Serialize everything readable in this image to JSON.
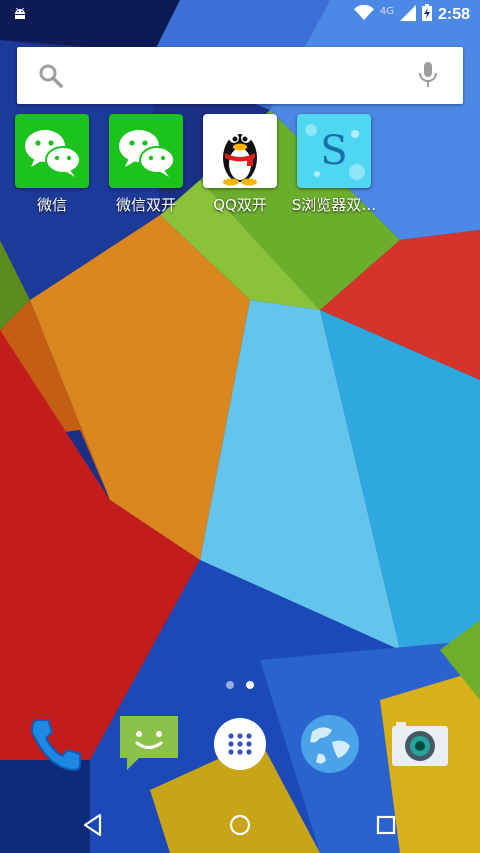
{
  "status_bar": {
    "network": "4G",
    "time": "2:58",
    "icons": [
      "android-debug-icon",
      "wifi-icon",
      "cell-signal-icon",
      "battery-charging-icon"
    ]
  },
  "search_bar": {
    "icons": [
      "search-icon",
      "microphone-icon"
    ]
  },
  "apps": [
    {
      "label": "微信",
      "icon": "wechat-icon"
    },
    {
      "label": "微信双开",
      "icon": "wechat-icon"
    },
    {
      "label": "QQ双开",
      "icon": "qq-penguin-icon"
    },
    {
      "label": "S浏览器双…",
      "icon": "s-browser-icon",
      "icon_letter": "S"
    }
  ],
  "page_indicator": {
    "pages": 2,
    "current": 2
  },
  "dock": [
    {
      "icon": "phone-icon"
    },
    {
      "icon": "messaging-icon"
    },
    {
      "icon": "app-drawer-icon"
    },
    {
      "icon": "browser-globe-icon"
    },
    {
      "icon": "camera-icon"
    }
  ],
  "nav_bar": {
    "icons": [
      "back-icon",
      "home-icon",
      "recents-icon"
    ]
  },
  "colors": {
    "wechat_green": "#1dc31d",
    "s_browser_cyan": "#4fd6f0",
    "white": "#ffffff"
  }
}
